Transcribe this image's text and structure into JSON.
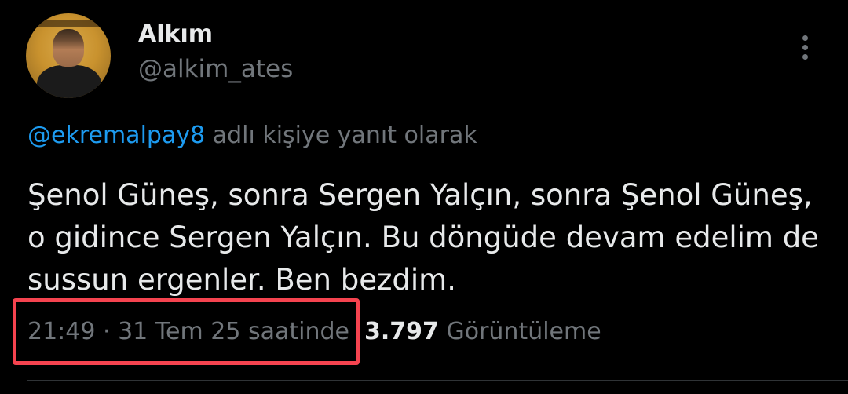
{
  "author": {
    "display_name": "Alkım",
    "handle": "@alkim_ates"
  },
  "reply_context": {
    "mention": "@ekremalpay8",
    "suffix": " adlı kişiye yanıt olarak"
  },
  "tweet": {
    "text": "Şenol Güneş, sonra Sergen Yalçın, sonra Şenol Güneş, o gidince Sergen Yalçın. Bu döngüde devam edelim de sussun ergenler. Ben bezdim."
  },
  "meta": {
    "time": "21:49",
    "separator": " · ",
    "date": "31 Tem 25 saatinde",
    "views_count": "3.797",
    "views_label": " Görüntüleme"
  },
  "icons": {
    "more": "more-vertical-icon"
  },
  "colors": {
    "background": "#000000",
    "primary_text": "#e7e9ea",
    "secondary_text": "#71767b",
    "link": "#1d9bf0",
    "highlight": "#f5434f"
  }
}
